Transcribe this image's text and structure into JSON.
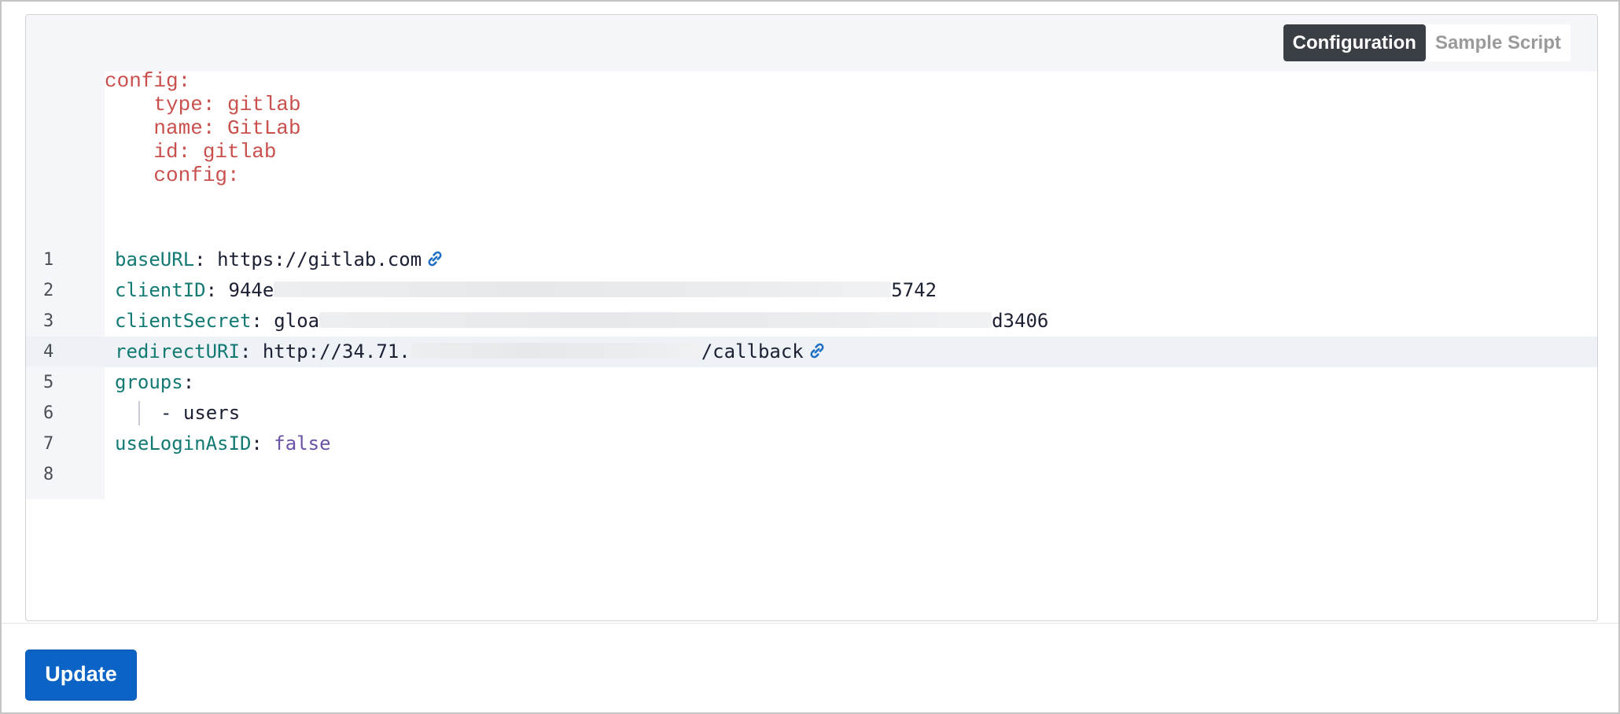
{
  "tabs": {
    "configuration": "Configuration",
    "sample_script": "Sample Script",
    "active": "configuration"
  },
  "preamble": [
    "config:",
    "    type: gitlab",
    "    name: GitLab",
    "    id: gitlab",
    "    config:"
  ],
  "code": {
    "lines": [
      {
        "num": "1",
        "key": "baseURL",
        "value": "https://gitlab.com"
      },
      {
        "num": "2",
        "key": "clientID",
        "value_start": "944e",
        "value_end": "5742"
      },
      {
        "num": "3",
        "key": "clientSecret",
        "value_start": "gloa",
        "value_end": "d3406"
      },
      {
        "num": "4",
        "key": "redirectURI",
        "value_start": "http://34.71.",
        "value_end": "/callback"
      },
      {
        "num": "5",
        "key": "groups"
      },
      {
        "num": "6",
        "value": "- users"
      },
      {
        "num": "7",
        "key": "useLoginAsID",
        "value": "false"
      },
      {
        "num": "8"
      }
    ]
  },
  "actions": {
    "update_label": "Update"
  },
  "colors": {
    "key": "#127a73",
    "boolean": "#6b52a6",
    "preamble": "#c9504d",
    "link_icon": "#1f6fc4",
    "primary_button": "#0b63c5",
    "active_tab": "#3a3f46"
  }
}
